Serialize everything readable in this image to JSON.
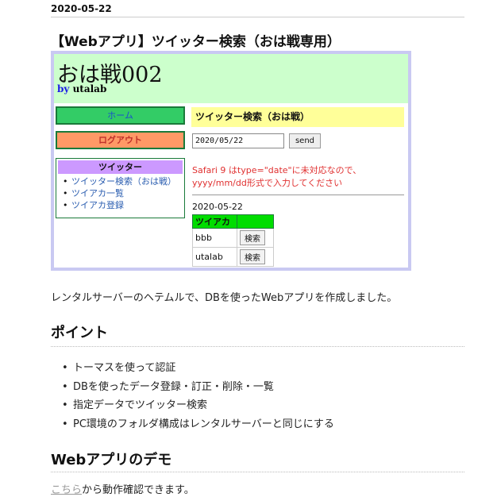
{
  "post": {
    "date": "2020-05-22",
    "title": "【Webアプリ】ツイッター検索（おは戦専用）"
  },
  "app": {
    "logo": "おは戦002",
    "by_label": "by",
    "author": "utalab",
    "home_button": "ホーム",
    "logout_button": "ログアウト",
    "twitter_menu": {
      "heading": "ツイッター",
      "items": [
        "ツイッター検索（おは戦）",
        "ツイアカ一覧",
        "ツイアカ登録"
      ]
    },
    "main_heading": "ツイッター検索（おは戦）",
    "date_input_value": "2020/05/22",
    "send_label": "send",
    "warning": [
      "Safari 9 はtype=\"date\"に未対応なので、",
      "yyyy/mm/dd形式で入力してください"
    ],
    "result_date": "2020-05-22",
    "table": {
      "headers": [
        "ツイアカ",
        ""
      ],
      "rows": [
        {
          "account": "bbb",
          "button": "検索"
        },
        {
          "account": "utalab",
          "button": "検索"
        }
      ]
    }
  },
  "content": {
    "description": "レンタルサーバーのヘテムルで、DBを使ったWebアプリを作成しました。",
    "points_heading": "ポイント",
    "points": [
      "トーマスを使って認証",
      "DBを使ったデータ登録・訂正・削除・一覧",
      "指定データでツイッター検索",
      "PC環境のフォルダ構成はレンタルサーバーと同じにする"
    ],
    "demo_heading": "Webアプリのデモ",
    "demo_link": "こちら",
    "demo_text": "から動作確認できます。"
  }
}
